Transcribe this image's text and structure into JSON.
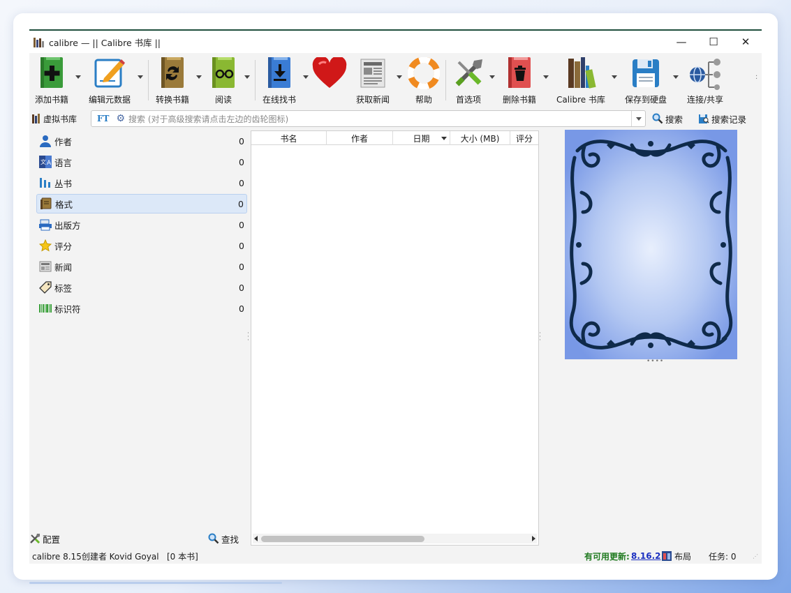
{
  "window": {
    "title": "calibre — || Calibre 书库 ||",
    "minimize": "—",
    "maximize": "☐",
    "close": "✕"
  },
  "toolbar": {
    "add_books": "添加书籍",
    "edit_metadata": "编辑元数据",
    "convert_books": "转换书籍",
    "view": "阅读",
    "get_books": "在线找书",
    "fetch_news": "获取新闻",
    "help": "帮助",
    "preferences": "首选项",
    "remove_books": "删除书籍",
    "library": "Calibre 书库",
    "save_to_disk": "保存到硬盘",
    "connect_share": "连接/共享"
  },
  "searchbar": {
    "virtual_library": "虚拟书库",
    "ft_label": "FT",
    "placeholder": "搜索 (对于高级搜索请点击左边的齿轮图标)",
    "search_button": "搜索",
    "saved_searches": "搜索记录"
  },
  "tag_browser": {
    "items": [
      {
        "label": "作者",
        "count": "0",
        "icon": "person-icon"
      },
      {
        "label": "语言",
        "count": "0",
        "icon": "language-icon"
      },
      {
        "label": "丛书",
        "count": "0",
        "icon": "series-icon"
      },
      {
        "label": "格式",
        "count": "0",
        "icon": "book-format-icon"
      },
      {
        "label": "出版方",
        "count": "0",
        "icon": "publisher-icon"
      },
      {
        "label": "评分",
        "count": "0",
        "icon": "star-icon"
      },
      {
        "label": "新闻",
        "count": "0",
        "icon": "news-icon"
      },
      {
        "label": "标签",
        "count": "0",
        "icon": "tag-icon"
      },
      {
        "label": "标识符",
        "count": "0",
        "icon": "barcode-icon"
      }
    ],
    "selected_index": 3,
    "configure": "配置",
    "find": "查找"
  },
  "book_list": {
    "columns": [
      "书名",
      "作者",
      "日期",
      "大小 (MB)",
      "评分"
    ],
    "rows": []
  },
  "status": {
    "left": "calibre 8.15创建者 Kovid Goyal",
    "book_count": "[0 本书]",
    "update_label": "有可用更新:",
    "update_version": "8.16.2",
    "layout": "布局",
    "jobs": "任务:  0"
  },
  "colors": {
    "accent_blue": "#2a7ec5",
    "selected_row": "#dce8f8",
    "update_green": "#1f7a1f",
    "cover_blue": "#a9bff0",
    "cover_ornament": "#0f2a4a"
  }
}
